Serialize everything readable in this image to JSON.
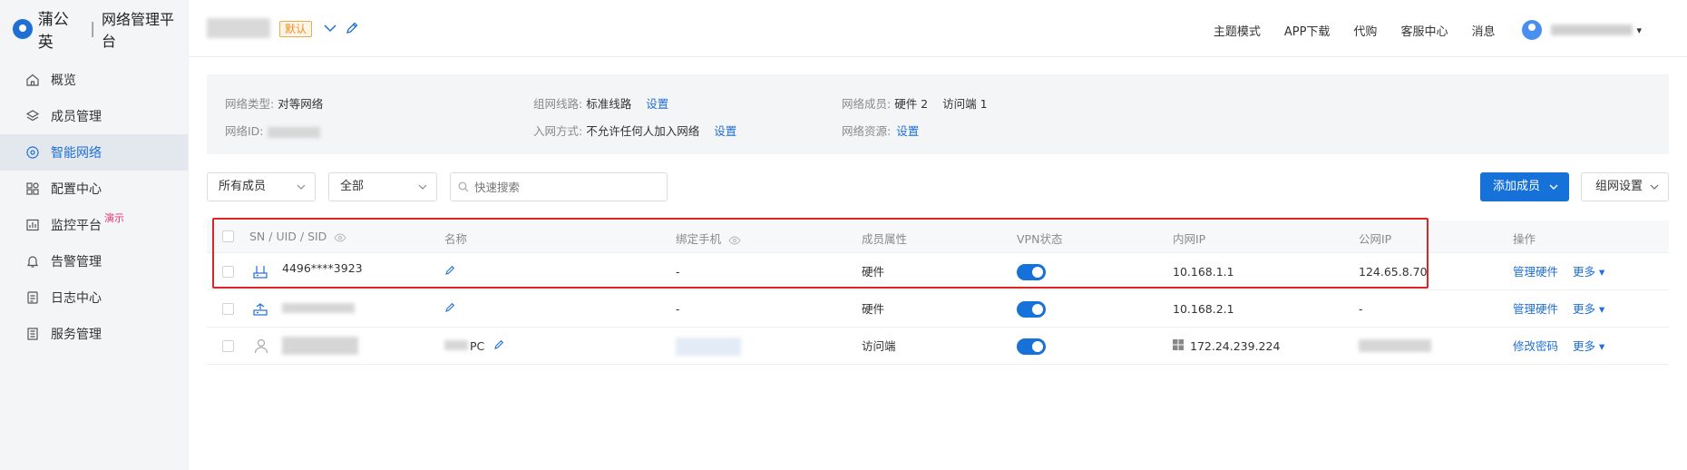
{
  "brand": {
    "name": "蒲公英",
    "separator": "|",
    "subtitle": "网络管理平台"
  },
  "sidebar": {
    "items": [
      {
        "label": "概览",
        "icon": "home-icon"
      },
      {
        "label": "成员管理",
        "icon": "layers-icon"
      },
      {
        "label": "智能网络",
        "icon": "network-icon",
        "active": true
      },
      {
        "label": "配置中心",
        "icon": "grid-icon"
      },
      {
        "label": "监控平台",
        "icon": "monitor-icon",
        "badge": "演示"
      },
      {
        "label": "告警管理",
        "icon": "bell-icon"
      },
      {
        "label": "日志中心",
        "icon": "log-icon"
      },
      {
        "label": "服务管理",
        "icon": "service-icon"
      }
    ]
  },
  "header": {
    "default_tag": "默认",
    "links": [
      "主题模式",
      "APP下载",
      "代购",
      "客服中心",
      "消息"
    ],
    "user_caret": "▾"
  },
  "info": {
    "network_type_label": "网络类型:",
    "network_type_value": "对等网络",
    "network_id_label": "网络ID:",
    "route_label": "组网线路:",
    "route_value": "标准线路",
    "route_action": "设置",
    "join_label": "入网方式:",
    "join_value": "不允许任何人加入网络",
    "join_action": "设置",
    "members_label": "网络成员:",
    "members_hw": "硬件 2",
    "members_client": "访问端 1",
    "resources_label": "网络资源:",
    "resources_action": "设置"
  },
  "filters": {
    "member_select": "所有成员",
    "status_select": "全部",
    "search_placeholder": "快速搜索",
    "add_member": "添加成员",
    "group_settings": "组网设置"
  },
  "table": {
    "headers": {
      "id": "SN / UID / SID",
      "name": "名称",
      "phone": "绑定手机",
      "attr": "成员属性",
      "vpn": "VPN状态",
      "lan_ip": "内网IP",
      "wan_ip": "公网IP",
      "ops": "操作"
    },
    "rows": [
      {
        "id": "4496****3923",
        "phone": "-",
        "attr": "硬件",
        "vpn": true,
        "lan_ip": "10.168.1.1",
        "wan_ip": "124.65.8.70",
        "action": "管理硬件",
        "more": "更多",
        "type_icon": "router-icon"
      },
      {
        "id": "",
        "phone": "-",
        "attr": "硬件",
        "vpn": true,
        "lan_ip": "10.168.2.1",
        "wan_ip": "-",
        "action": "管理硬件",
        "more": "更多",
        "type_icon": "router-icon"
      },
      {
        "id": "",
        "name_suffix": "PC",
        "phone": "",
        "attr": "访问端",
        "vpn": true,
        "lan_ip": "172.24.239.224",
        "wan_ip": "",
        "action": "修改密码",
        "more": "更多",
        "type_icon": "user-icon"
      }
    ]
  },
  "colors": {
    "accent": "#1671d8",
    "highlight": "#e02424",
    "tag": "#ef8f1d",
    "demo": "#e5346b"
  }
}
